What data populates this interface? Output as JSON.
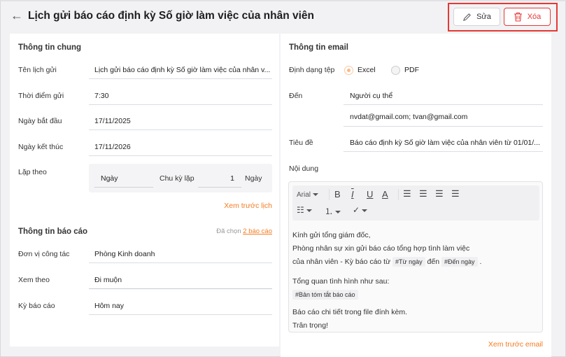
{
  "header": {
    "title": "Lịch gửi báo cáo định kỳ Số giờ làm việc của nhân viên",
    "edit_label": "Sửa",
    "delete_label": "Xóa"
  },
  "general": {
    "heading": "Thông tin chung",
    "fields": [
      {
        "label": "Tên lịch gửi",
        "value": "Lịch gửi báo cáo định kỳ Số giờ làm việc của nhân v..."
      },
      {
        "label": "Thời điểm gửi",
        "value": "7:30"
      },
      {
        "label": "Ngày bắt đầu",
        "value": "17/11/2025"
      },
      {
        "label": "Ngày kết thúc",
        "value": "17/11/2026"
      }
    ],
    "repeat": {
      "label": "Lặp theo",
      "unit": "Ngày",
      "cycle_label": "Chu kỳ lặp",
      "cycle_value": "1",
      "cycle_unit": "Ngày"
    },
    "preview_link": "Xem trước lịch"
  },
  "report": {
    "heading": "Thông tin báo cáo",
    "selected_prefix": "Đã chọn",
    "selected_link": "2 báo cáo",
    "fields": [
      {
        "label": "Đơn vị công tác",
        "value": "Phòng Kinh doanh"
      },
      {
        "label": "Xem theo",
        "value": "Đi muộn"
      },
      {
        "label": "Kỳ báo cáo",
        "value": "Hôm nay"
      }
    ]
  },
  "email": {
    "heading": "Thông tin email",
    "format_label": "Định dạng tệp",
    "format_options": [
      "Excel",
      "PDF"
    ],
    "format_selected": "Excel",
    "to_label": "Đến",
    "to_type": "Người cụ thể",
    "to_addresses": "nvdat@gmail.com; tvan@gmail.com",
    "subject_label": "Tiêu đề",
    "subject": "Báo cáo định kỳ Số giờ làm việc của nhân viên từ 01/01/...",
    "content_label": "Nội dung",
    "editor": {
      "font": "Arial",
      "body": {
        "l1": "Kính gửi tổng giám đốc,",
        "l2": "Phòng nhân sự xin gửi báo cáo tổng hợp tình làm việc",
        "l3a": "của nhân viên - Kỳ báo cáo từ",
        "tag_from": "#Từ ngày",
        "l3b": "đến",
        "tag_to": "#Đến ngày",
        "l3c": ".",
        "l4": "Tổng quan tình hình như sau:",
        "tag_summary": "#Bản tóm tắt báo cáo",
        "l5": "Báo cáo chi tiết trong file đính kèm.",
        "l6": "Trân trọng!"
      }
    },
    "preview_link": "Xem trước email"
  },
  "colors": {
    "accent": "#f47b20",
    "danger": "#e53935"
  }
}
